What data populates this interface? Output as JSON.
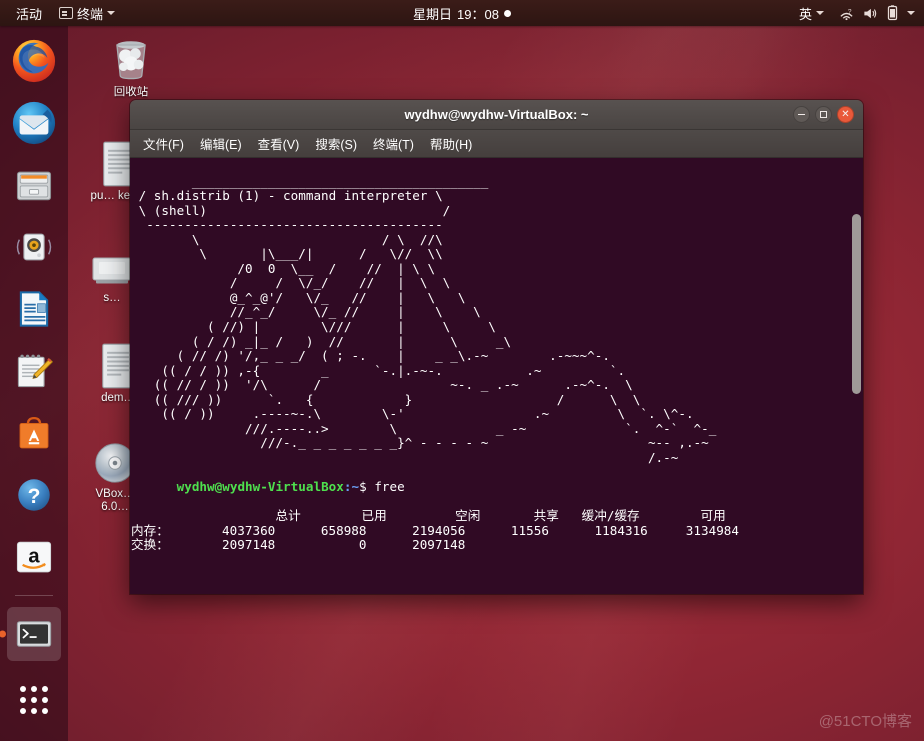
{
  "top_panel": {
    "activities_label": "活动",
    "app_menu": {
      "icon": "terminal-icon",
      "label": "终端",
      "caret": "▾"
    },
    "clock": {
      "weekday": "星期日",
      "time": "19：08",
      "indicator": "notification-dot"
    },
    "tray": {
      "input_method": {
        "label": "英",
        "caret": "▾"
      },
      "icons": [
        "network-icon",
        "volume-icon",
        "battery-icon"
      ],
      "system_caret": "▾"
    }
  },
  "dock": {
    "items": [
      {
        "name": "firefox",
        "label": "Firefox",
        "icon": "firefox-icon",
        "active": false
      },
      {
        "name": "thunderbird",
        "label": "Thunderbird Mail",
        "icon": "thunderbird-icon",
        "active": false
      },
      {
        "name": "files",
        "label": "Files",
        "icon": "file-cabinet-icon",
        "active": false
      },
      {
        "name": "rhythmbox",
        "label": "Rhythmbox",
        "icon": "speaker-icon",
        "active": false
      },
      {
        "name": "libreoffice-writer",
        "label": "LibreOffice Writer",
        "icon": "document-icon",
        "active": false
      },
      {
        "name": "text-editor",
        "label": "Text Editor",
        "icon": "notepad-pencil-icon",
        "active": false
      },
      {
        "name": "ubuntu-software",
        "label": "Ubuntu Software",
        "icon": "shopping-bag-a-icon",
        "active": false
      },
      {
        "name": "help",
        "label": "Help",
        "icon": "question-mark-icon",
        "active": false
      },
      {
        "name": "amazon",
        "label": "Amazon",
        "icon": "amazon-icon",
        "active": false
      },
      {
        "name": "terminal",
        "label": "Terminal",
        "icon": "terminal-icon",
        "active": true
      }
    ],
    "show_apps_label": "显示应用程序"
  },
  "desktop_icons": [
    {
      "name": "trash",
      "label": "回收站",
      "icon": "trash-icon"
    },
    {
      "name": "public-key-file",
      "label": "pu… key…",
      "icon": "text-file-icon"
    },
    {
      "name": "disk-drive",
      "label": "s…",
      "icon": "drive-icon"
    },
    {
      "name": "demo-file",
      "label": "dem…",
      "icon": "text-file-icon"
    },
    {
      "name": "vbox-guest-additions",
      "label": "VBox… 6.0…",
      "icon": "cd-disc-icon"
    }
  ],
  "terminal": {
    "title": "wydhw@wydhw-VirtualBox: ~",
    "window_buttons": {
      "minimize": "minimize-button",
      "maximize": "maximize-button",
      "close": "close-button"
    },
    "menus": [
      {
        "name": "file",
        "label": "文件(F)"
      },
      {
        "name": "edit",
        "label": "编辑(E)"
      },
      {
        "name": "view",
        "label": "查看(V)"
      },
      {
        "name": "search",
        "label": "搜索(S)"
      },
      {
        "name": "terminal",
        "label": "终端(T)"
      },
      {
        "name": "help",
        "label": "帮助(H)"
      }
    ],
    "ascii_art": "  _______________________________________\n / sh.distrib (1) - command interpreter \\\n \\ (shell)                               /\n  ---------------------------------------\n        \\                        / \\  //\\\n         \\       |\\___/|      /   \\//  \\\\\n              /0  0  \\__  /    //  | \\ \\\n             /     /  \\/_/    //   |  \\  \\\n             @_^_@'/   \\/_   //    |   \\   \\\n             //_^_/     \\/_ //     |    \\    \\\n          ( //) |        \\///      |     \\     \\\n        ( / /) _|_ /   )  //       |      \\     _\\\n      ( // /) '/,_ _ _/  ( ; -.    |    _ _\\.-~        .-~~~^-.\n    (( / / )) ,-{        _      `-.|.-~-.           .~         `.\n   (( // / ))  '/\\      /                 ~-. _ .-~      .-~^-.  \\\n   (( /// ))      `.   {            }                   /      \\  \\\n    (( / ))     .----~-.\\        \\-'                 .~         \\  `. \\^-.\n               ///.----..>        \\             _ -~             `.  ^-`  ^-_\n                 ///-._ _ _ _ _ _ _}^ - - - - ~                     ~-- ,.-~\n                                                                    /.-~",
    "prompt": {
      "user_host": "wydhw@wydhw-VirtualBox",
      "path": ":~",
      "symbol": "$ ",
      "command": "free"
    },
    "free_output": {
      "headers": [
        "",
        "总计",
        "已用",
        "空闲",
        "共享",
        "缓冲/缓存",
        "可用"
      ],
      "rows": [
        {
          "label": "内存：",
          "values": [
            "4037360",
            "658988",
            "2194056",
            "11556",
            "1184316",
            "3134984"
          ]
        },
        {
          "label": "交换：",
          "values": [
            "2097148",
            "0",
            "2097148",
            "",
            "",
            ""
          ]
        }
      ]
    }
  },
  "watermark": "@51CTO博客",
  "colors": {
    "terminal_bg": "#300a24",
    "terminal_fg": "#ffffff",
    "prompt_green": "#4ee04e",
    "prompt_blue": "#6a9ff5",
    "titlebar": "#4a4543",
    "panel_bg": "#2d1512",
    "dock_bg": "rgba(38,8,22,0.55)",
    "close_button": "#e9593a",
    "accent_orange": "#e8622a"
  }
}
